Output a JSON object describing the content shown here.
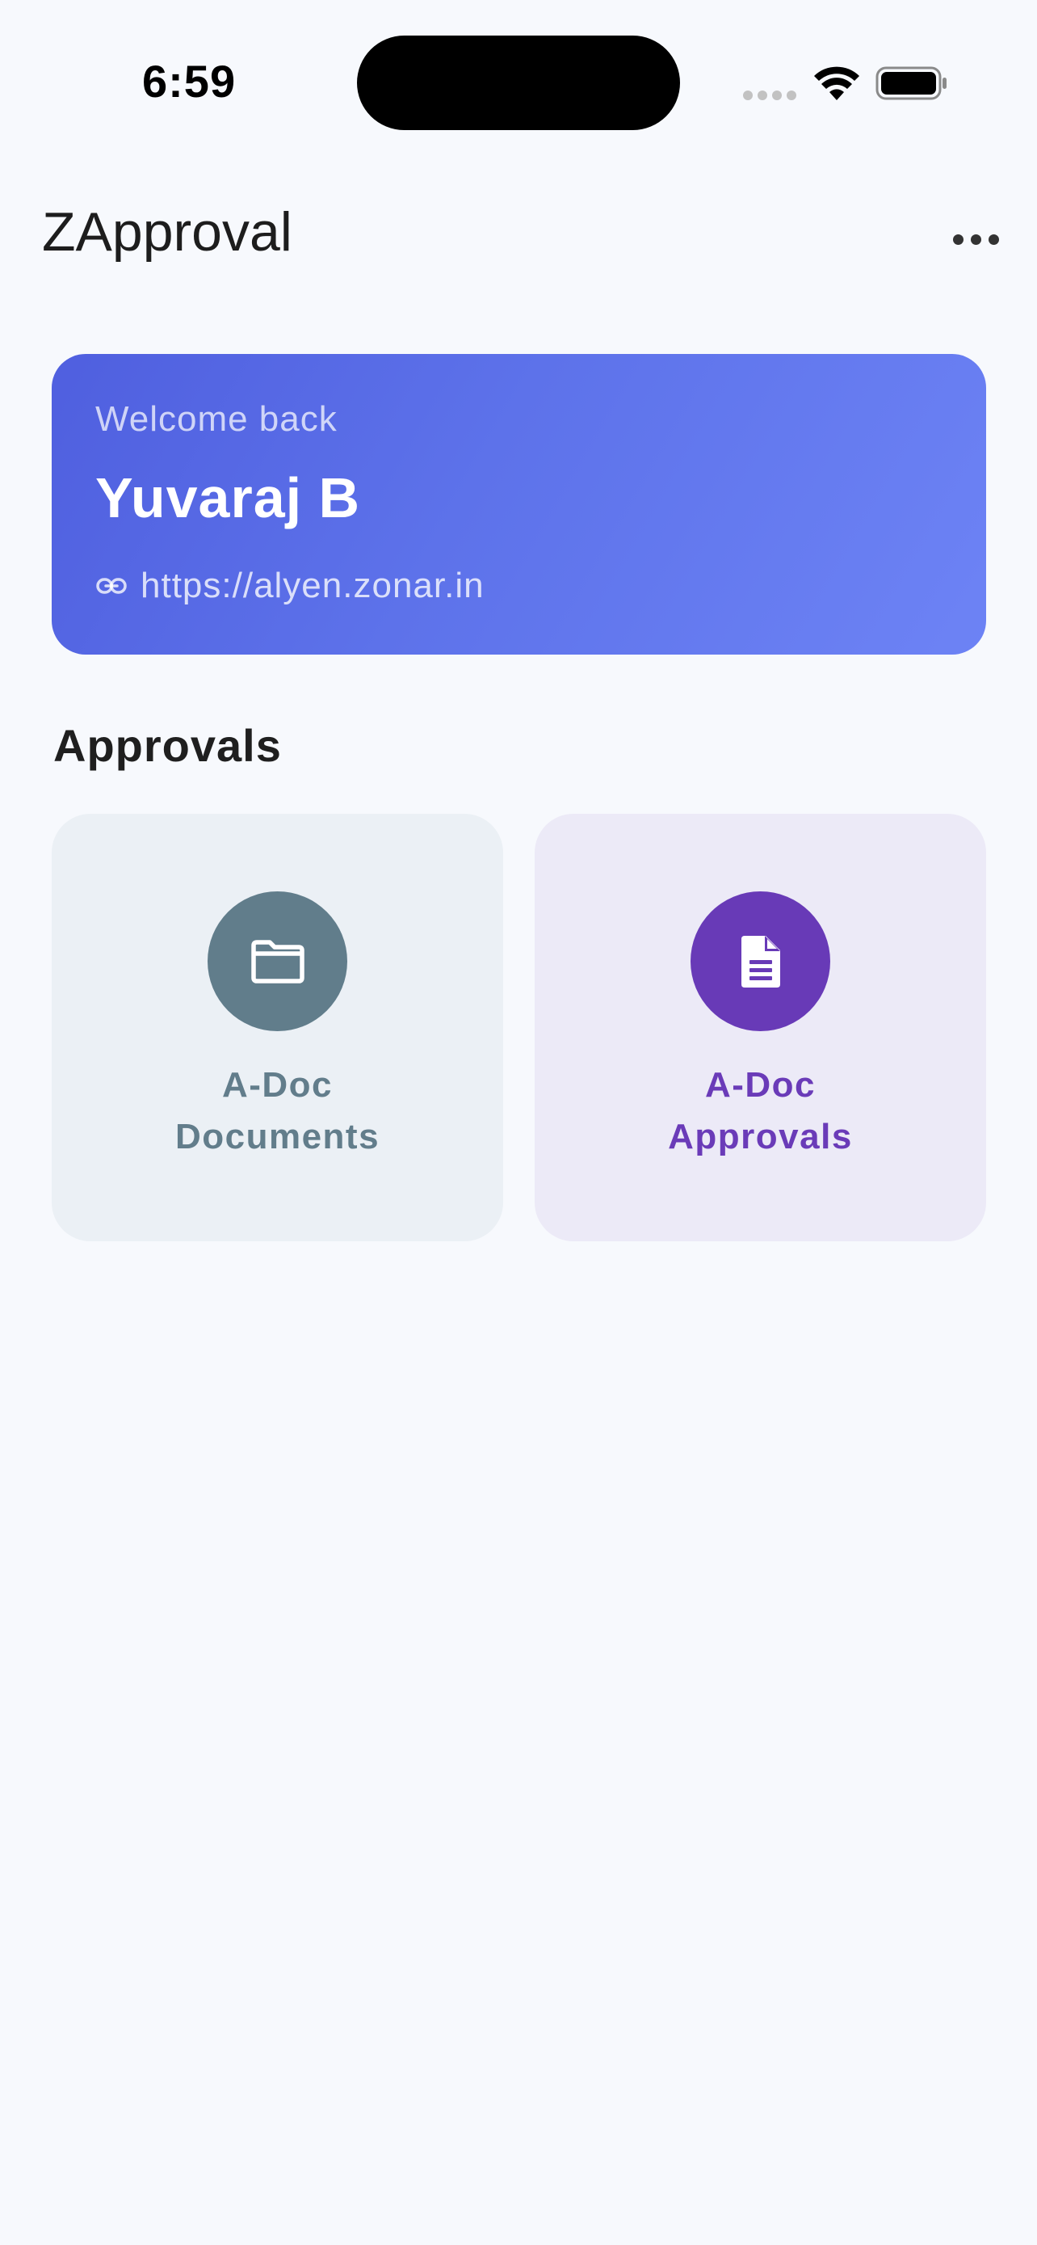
{
  "status_bar": {
    "time": "6:59",
    "icons": [
      "cellular-signal-icon",
      "wifi-icon",
      "battery-icon"
    ]
  },
  "app_bar": {
    "title": "ZApproval",
    "menu_icon": "more-horizontal-icon"
  },
  "welcome_card": {
    "greeting": "Welcome back",
    "user_name": "Yuvaraj B",
    "server_url": "https://alyen.zonar.in",
    "link_icon": "link-icon",
    "gradient_start": "#4f5fdf",
    "gradient_end": "#6d83f5"
  },
  "approvals_section": {
    "title": "Approvals",
    "tiles": [
      {
        "line1": "A-Doc",
        "line2": "Documents",
        "icon": "folder-icon",
        "accent": "#617d8b",
        "background": "#ebf0f5"
      },
      {
        "line1": "A-Doc",
        "line2": "Approvals",
        "icon": "document-icon",
        "accent": "#683ab7",
        "background": "#eceaf7"
      }
    ]
  }
}
